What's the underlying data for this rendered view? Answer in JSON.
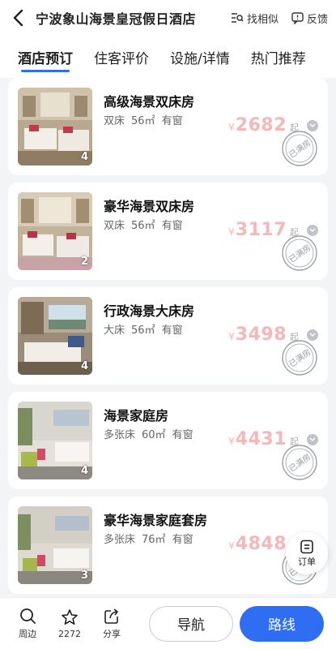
{
  "header": {
    "title": "宁波象山海景皇冠假日酒店",
    "find_similar_label": "找相似",
    "feedback_label": "反馈"
  },
  "tabs": [
    {
      "label": "酒店预订",
      "active": true
    },
    {
      "label": "住客评价",
      "active": false
    },
    {
      "label": "设施/详情",
      "active": false
    },
    {
      "label": "热门推荐",
      "active": false
    }
  ],
  "rooms": [
    {
      "name": "高级海景双床房",
      "bed": "双床",
      "area": "56㎡",
      "window": "有窗",
      "price": "2682",
      "currency": "¥",
      "suffix": "起",
      "photos": "4",
      "status": "已满房"
    },
    {
      "name": "豪华海景双床房",
      "bed": "双床",
      "area": "56㎡",
      "window": "有窗",
      "price": "3117",
      "currency": "¥",
      "suffix": "起",
      "photos": "2",
      "status": "已满房"
    },
    {
      "name": "行政海景大床房",
      "bed": "大床",
      "area": "56㎡",
      "window": "有窗",
      "price": "3498",
      "currency": "¥",
      "suffix": "起",
      "photos": "4",
      "status": "已满房"
    },
    {
      "name": "海景家庭房",
      "bed": "多张床",
      "area": "60㎡",
      "window": "有窗",
      "price": "4431",
      "currency": "¥",
      "suffix": "起",
      "photos": "4",
      "status": "已满房"
    },
    {
      "name": "豪华海景家庭套房",
      "bed": "多张床",
      "area": "76㎡",
      "window": "有窗",
      "price": "4848",
      "currency": "¥",
      "suffix": "起",
      "photos": "3",
      "status": "已满房"
    }
  ],
  "order_fab": {
    "label": "订单"
  },
  "bottom_bar": {
    "nearby_label": "周边",
    "favorite_count": "2272",
    "share_label": "分享",
    "navigate_label": "导航",
    "route_label": "路线"
  },
  "colors": {
    "accent": "#2f6ef3",
    "price": "#f6b7b7"
  }
}
